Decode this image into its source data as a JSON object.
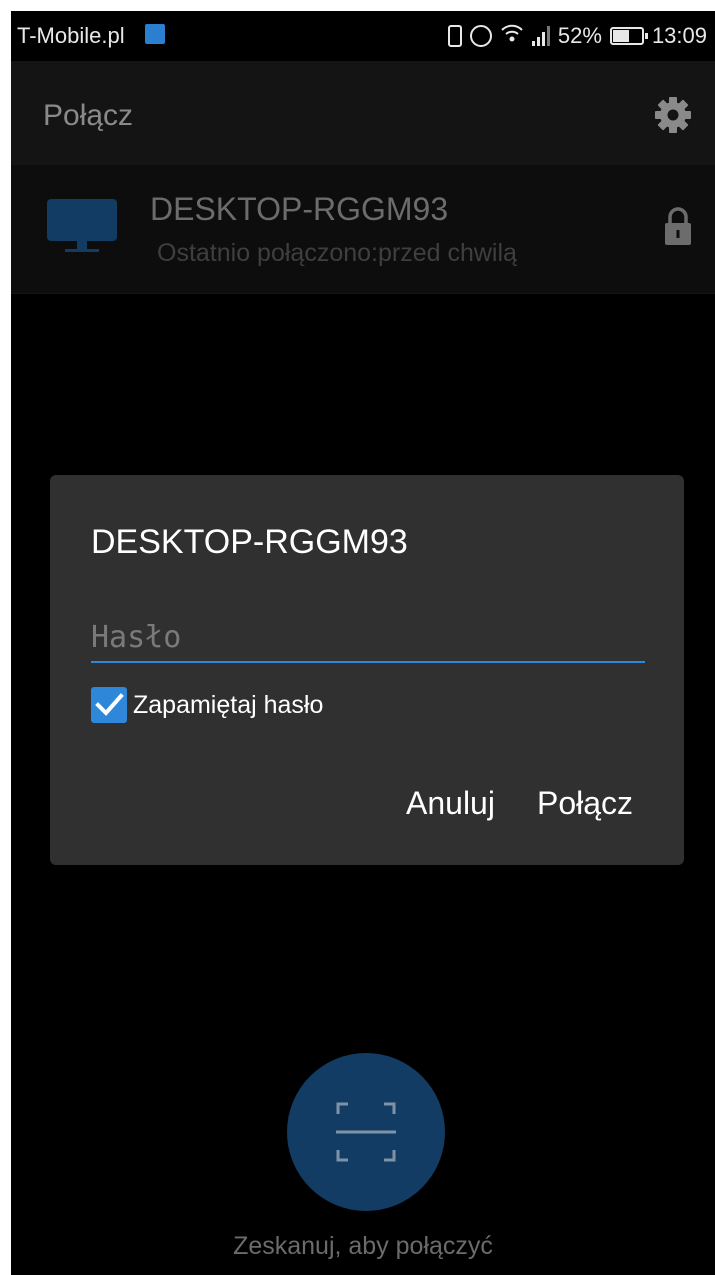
{
  "status_bar": {
    "carrier": "T-Mobile.pl",
    "battery": "52%",
    "time": "13:09",
    "icons": [
      "sim-icon",
      "vibrate-icon",
      "alarm-icon",
      "wifi-icon",
      "signal-icon",
      "battery-icon"
    ]
  },
  "app_bar": {
    "title": "Połącz",
    "settings_icon": "gear-icon"
  },
  "device": {
    "name": "DESKTOP-RGGM93",
    "last_connected": "Ostatnio połączono:przed chwilą",
    "icon": "monitor-icon",
    "lock_icon": "lock-icon"
  },
  "dialog": {
    "title": "DESKTOP-RGGM93",
    "password_value": "",
    "password_placeholder": "Hasło",
    "remember_label": "Zapamiętaj hasło",
    "remember_checked": true,
    "cancel_label": "Anuluj",
    "connect_label": "Połącz"
  },
  "scan": {
    "icon": "scan-icon",
    "label": "Zeskanuj, aby połączyć"
  },
  "colors": {
    "accent": "#2f87d9",
    "dialog_bg": "#303030",
    "scan_button": "#123c63",
    "background": "#000000"
  }
}
